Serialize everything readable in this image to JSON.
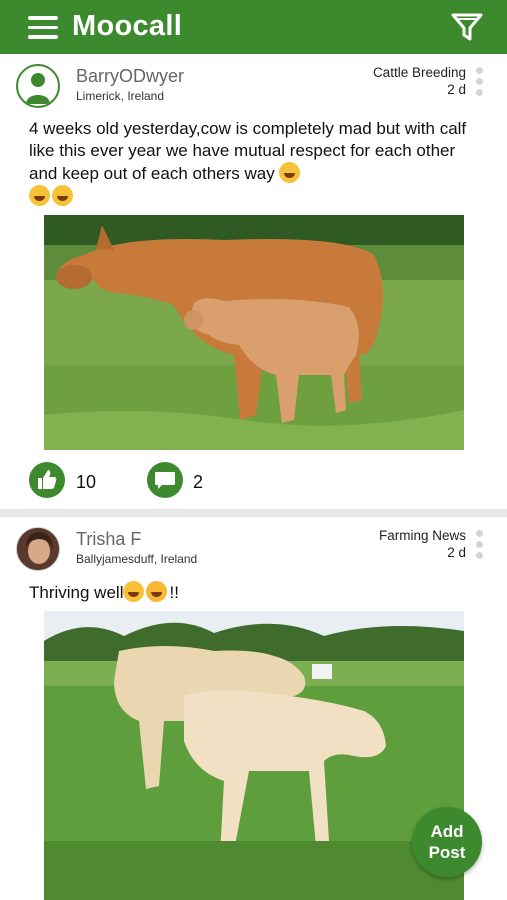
{
  "header": {
    "title": "Moocall"
  },
  "posts": [
    {
      "username": "BarryODwyer",
      "location": "Limerick, Ireland",
      "category": "Cattle Breeding",
      "age": "2 d",
      "text": "4 weeks old yesterday,cow is completely mad but with calf like this ever year we have mutual respect for each other and keep out of each others way",
      "likes": "10",
      "comments": "2"
    },
    {
      "username": "Trisha F",
      "location": "Ballyjamesduff, Ireland",
      "category": "Farming News",
      "age": "2 d",
      "text": "Thriving well",
      "text_suffix": "!!"
    }
  ],
  "fab": {
    "label_line1": "Add",
    "label_line2": "Post"
  },
  "colors": {
    "brand": "#3d8a2e",
    "background": "#e9e9e9"
  },
  "icons": [
    "menu-icon",
    "filter-icon",
    "user-icon",
    "more-icon",
    "thumbs-up-icon",
    "comment-icon",
    "emoji-laughing",
    "emoji-kiss",
    "emoji-ok-hand"
  ]
}
